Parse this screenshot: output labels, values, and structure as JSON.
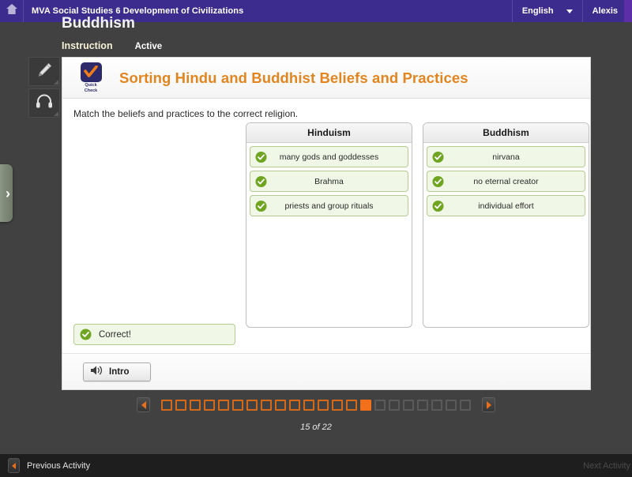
{
  "topbar": {
    "home_icon": "home-icon",
    "course_title": "MVA Social Studies 6 Development of Civilizations",
    "language": "English",
    "language_chevron": "chevron-down-icon",
    "user": "Alexis"
  },
  "page": {
    "title": "Buddhism",
    "tabs": [
      {
        "label": "Instruction"
      },
      {
        "label": "Active"
      }
    ]
  },
  "tools": [
    {
      "icon": "pencil-icon"
    },
    {
      "icon": "headphones-icon"
    }
  ],
  "side_tab": {
    "icon": "chevron-right-icon"
  },
  "activity": {
    "badge": {
      "icon": "orange-checkmark-icon",
      "line1": "Quick",
      "line2": "Check"
    },
    "title": "Sorting Hindu and Buddhist Beliefs and Practices",
    "prompt": "Match the beliefs and practices to the correct religion.",
    "columns": [
      {
        "header": "Hinduism",
        "items": [
          {
            "label": "many gods and goddesses",
            "status_icon": "green-check-icon"
          },
          {
            "label": "Brahma",
            "status_icon": "green-check-icon"
          },
          {
            "label": "priests and group rituals",
            "status_icon": "green-check-icon"
          }
        ]
      },
      {
        "header": "Buddhism",
        "items": [
          {
            "label": "nirvana",
            "status_icon": "green-check-icon"
          },
          {
            "label": "no eternal creator",
            "status_icon": "green-check-icon"
          },
          {
            "label": "individual effort",
            "status_icon": "green-check-icon"
          }
        ]
      }
    ],
    "feedback": {
      "text": "Correct!",
      "icon": "green-check-icon"
    },
    "audio_button": {
      "label": "Intro",
      "icon": "speaker-icon"
    }
  },
  "pager": {
    "prev_icon": "triangle-left-icon",
    "next_icon": "triangle-right-icon",
    "total": 22,
    "current": 15,
    "count_label": "15 of 22"
  },
  "bottombar": {
    "prev_icon": "triangle-left-icon",
    "prev_label": "Previous Activity",
    "next_label": "Next Activity"
  },
  "colors": {
    "brand_purple": "#3b2c8e",
    "accent_orange": "#e2851f",
    "pager_orange": "#f2701a",
    "correct_green": "#6fa520",
    "item_bg": "#f1f7e7",
    "item_border": "#b5cb92"
  }
}
